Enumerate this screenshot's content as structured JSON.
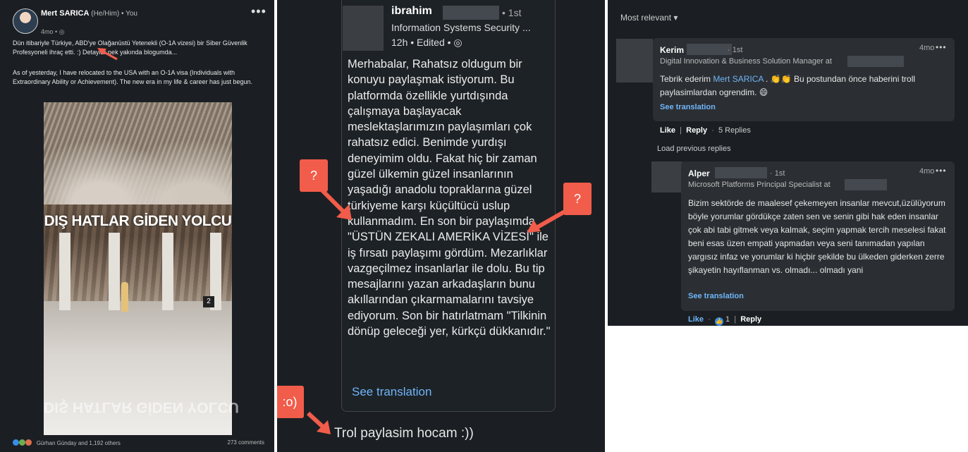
{
  "left_post": {
    "author_name": "Mert SARICA",
    "author_meta": "(He/Him) • You",
    "age": "4mo •",
    "more": "•••",
    "text_tr": "Dün itibariyle Türkiye, ABD'ye Olağanüstü Yetenekli (O-1A vizesi) bir Siber Güvenlik Profesyoneli ihraç etti. :) Detaylar pek yakında blogumda...",
    "text_en": "As of yesterday, I have relocated to the USA with an O-1A visa (Individuals with Extraordinary Ability or Achievement). The new era in my life & career has just begun.",
    "photo_sign": "DIŞ HATLAR GİDEN YOLCU",
    "photo_gate": "2",
    "reactions": "Gürhan Günday and 1,192 others",
    "comments": "273 comments"
  },
  "middle_comment": {
    "name": "ibrahim",
    "degree": "• 1st",
    "headline": "Information Systems Security ...",
    "time": "12h • Edited •",
    "body": "Merhabalar, Rahatsız oldugum bir konuyu paylaşmak istiyorum. Bu platformda özellikle yurtdışında çalışmaya başlayacak meslektaşlarımızın paylaşımları çok rahatsız edici. Benimde yurdışı deneyimim oldu. Fakat hiç bir zaman güzel ülkemin güzel insanlarının yaşadığı anadolu topraklarına güzel türkiyeme karşı küçültücü uslup kullanmadım. En son bir paylaşımda \"ÜSTÜN ZEKALI AMERİKA VİZESİ\" ile iş fırsatı paylaşımı gördüm. Mezarlıklar vazgeçilmez insanlarlar ile dolu. Bu tip mesajlarını yazan arkadaşların bunu akıllarından çıkarmamalarını tavsiye ediyorum.  Son bir hatırlatmam \"Tilkinin dönüp geleceği yer, kürkçü dükkanıdır.\"",
    "see_translation": "See translation",
    "callout_left": "?",
    "callout_right": "?",
    "callout_reply": ":o)",
    "reply_text": "Trol paylasim hocam :))"
  },
  "right_comments": {
    "sort": "Most relevant ▾",
    "kerim": {
      "name": "Kerim",
      "degree": "· 1st",
      "time": "4mo",
      "more": "•••",
      "headline": "Digital Innovation & Business Solution Manager at",
      "body_pre": "Tebrik ederim ",
      "mention": "Mert SARICA",
      "body_post": " . 👏👏 Bu postundan önce haberini troll paylasimlardan ogrendim. 😄",
      "see_translation": "See translation",
      "like": "Like",
      "reply": "Reply",
      "replies": "5 Replies"
    },
    "load_previous": "Load previous replies",
    "alper": {
      "name": "Alper",
      "degree": "· 1st",
      "time": "4mo",
      "more": "•••",
      "headline": "Microsoft Platforms Principal Specialist at",
      "body": "Bizim sektörde de maalesef çekemeyen insanlar mevcut,üzülüyorum böyle yorumlar gördükçe zaten sen ve senin gibi hak eden insanlar çok abi tabi gitmek veya kalmak, seçim yapmak tercih meselesi fakat beni esas üzen empati yapmadan veya seni tanımadan yapılan yargısız infaz ve yorumlar ki hiçbir şekilde bu ülkeden giderken zerre şikayetin hayıflanman vs. olmadı... olmadı yani",
      "see_translation": "See translation",
      "like": "Like",
      "like_count": "1",
      "reply": "Reply"
    }
  },
  "colors": {
    "background": "#1b1f23",
    "card": "#2b2f33",
    "accent_link": "#70b5f9",
    "callout_red": "#f25c4a"
  }
}
